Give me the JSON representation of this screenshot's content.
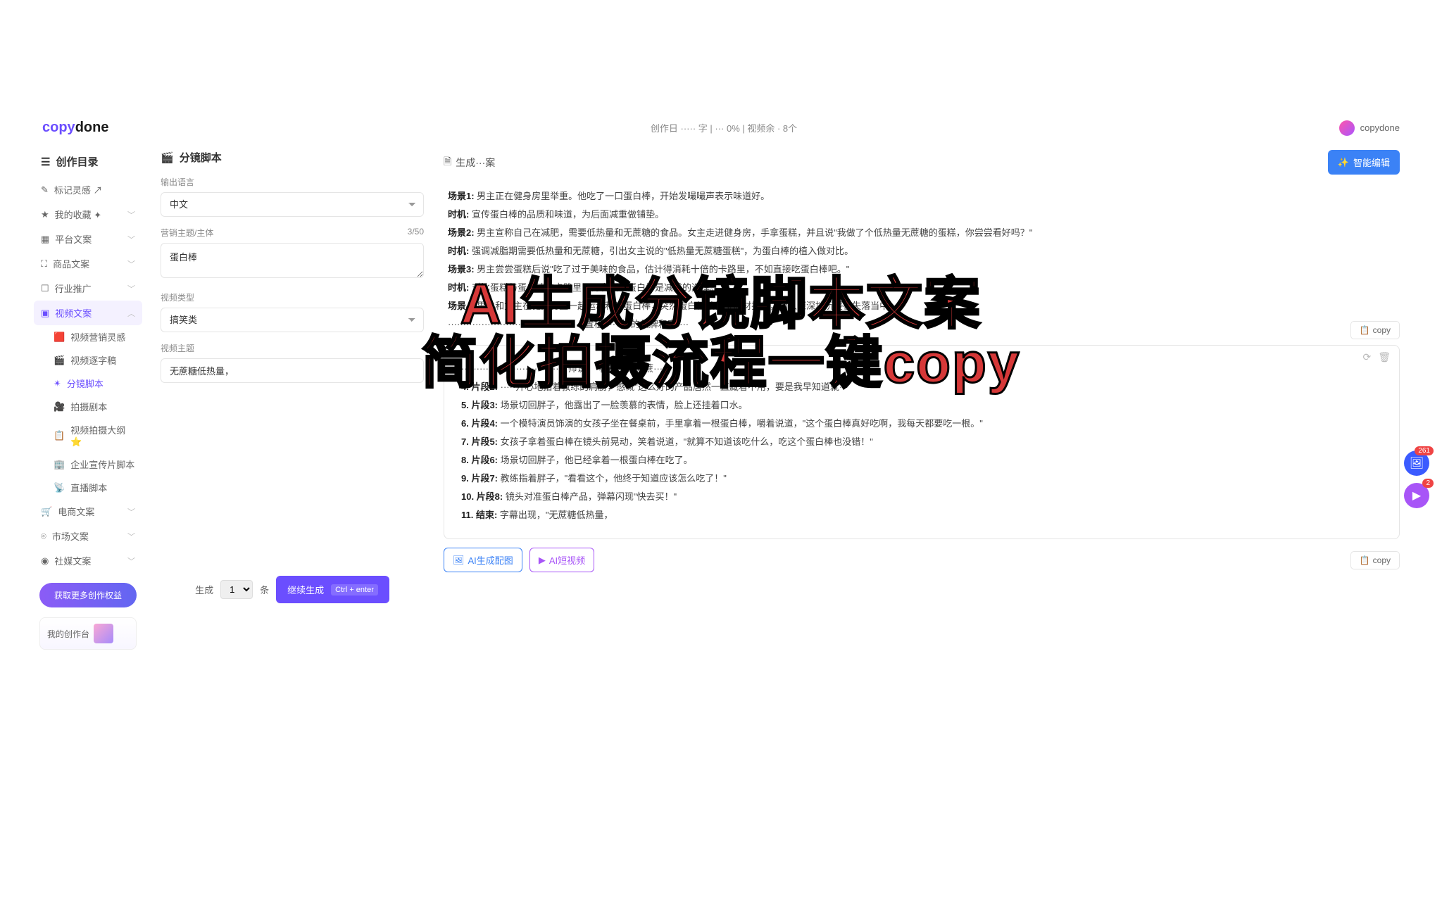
{
  "brand": {
    "p1": "copy",
    "p2": "done"
  },
  "top": {
    "center": "创作日 ····· 字 | ··· 0% | 视频余 · 8个",
    "user": "copydone"
  },
  "sidebar": {
    "title": "创作目录",
    "items": [
      {
        "icon": "✎",
        "label": "标记灵感 ↗"
      },
      {
        "icon": "★",
        "label": "我的收藏 ✦",
        "chev": true
      },
      {
        "icon": "▦",
        "label": "平台文案",
        "chev": true
      },
      {
        "icon": "⛶",
        "label": "商品文案",
        "chev": true
      },
      {
        "icon": "☐",
        "label": "行业推广",
        "chev": true
      },
      {
        "icon": "▣",
        "label": "视频文案",
        "chev": true,
        "active": true
      },
      {
        "icon": "🛒",
        "label": "电商文案",
        "chev": true
      },
      {
        "icon": "⌾",
        "label": "市场文案",
        "chev": true
      },
      {
        "icon": "◉",
        "label": "社媒文案",
        "chev": true
      }
    ],
    "sub": [
      {
        "icon": "🟥",
        "label": "视频营销灵感"
      },
      {
        "icon": "🎬",
        "label": "视频逐字稿"
      },
      {
        "icon": "✴",
        "label": "分镜脚本",
        "sel": true
      },
      {
        "icon": "🎥",
        "label": "拍摄剧本"
      },
      {
        "icon": "📋",
        "label": "视频拍摄大纲 ⭐"
      },
      {
        "icon": "🏢",
        "label": "企业宣传片脚本"
      },
      {
        "icon": "📡",
        "label": "直播脚本"
      }
    ],
    "upgrade": "获取更多创作权益",
    "workbench": "我的创作台"
  },
  "form": {
    "title": "分镜脚本",
    "lang_label": "输出语言",
    "lang_value": "中文",
    "topic_label": "营销主题/主体",
    "topic_count": "3/50",
    "topic_value": "蛋白棒",
    "type_label": "视频类型",
    "type_value": "搞笑类",
    "theme_label": "视频主题",
    "theme_value": "无蔗糖低热量，",
    "gen_label": "生成",
    "gen_count": "1",
    "gen_unit": "条",
    "gen_btn": "继续生成",
    "gen_kb": "Ctrl + enter"
  },
  "output": {
    "head": "生成···案",
    "smart": "智能编辑",
    "copy": "copy",
    "lines1": [
      "<b>场景1:</b> 男主正在健身房里举重。他吃了一口蛋白棒，开始发嘬嘬声表示味道好。",
      "<b>时机:</b> 宣传蛋白棒的品质和味道，为后面减重做铺垫。",
      "<b>场景2:</b> 男主宣称自己在减肥，需要低热量和无蔗糖的食品。女主走进健身房，手拿蛋糕，并且说\"我做了个低热量无蔗糖的蛋糕，你尝尝看好吗？\"",
      "<b>时机:</b> 强调减脂期需要低热量和无蔗糖，引出女主说的\"低热量无蔗糖蛋糕\"，为蛋白棒的植入做对比。",
      "<b>场景3:</b> 男主尝尝蛋糕后说\"吃了过于美味的食品，估计得消耗十倍的卡路里，不如直接吃蛋白棒吧。\"",
      "<b>时机:</b> 对比蛋糕与蛋白棒的卡路里，再次强调蛋白棒是减重的选择。",
      "<b>场景4:</b> 男主和女主在健身房里一起运动和吃蛋白棒，突然蛋白棒被健身器材挂住，两人深深地沉浸在失落当中。",
      "·············································置植······棒的品牌和宣····"
    ],
    "lines2": [
      "···································师说，\"看这个，无蔗···",
      "<b>4. 片段2:</b> ·····开心地拍着教练的肩膀，感慨\"这么好的产品居然一直藏着不用，要是我早知道就···",
      "<b>5. 片段3:</b> 场景切回胖子，他露出了一脸羡慕的表情，脸上还挂着口水。",
      "<b>6. 片段4:</b> 一个模特演员饰演的女孩子坐在餐桌前，手里拿着一根蛋白棒，嚼着说道，\"这个蛋白棒真好吃啊，我每天都要吃一根。\"",
      "<b>7. 片段5:</b> 女孩子拿着蛋白棒在镜头前晃动，笑着说道，\"就算不知道该吃什么，吃这个蛋白棒也没错！\"",
      "<b>8. 片段6:</b> 场景切回胖子，他已经拿着一根蛋白棒在吃了。",
      "<b>9. 片段7:</b> 教练指着胖子，\"看看这个，他终于知道应该怎么吃了！\"",
      "<b>10. 片段8:</b> 镜头对准蛋白棒产品，弹幕闪现\"快去买！\"",
      "<b>11. 结束:</b> 字幕出现，\"无蔗糖低热量，"
    ],
    "ai_img": "AI生成配图",
    "ai_vid": "AI短视频"
  },
  "overlay": {
    "l1": "AI生成分镜脚本文案",
    "l2": "简化拍摄流程一键copy"
  },
  "floats": {
    "b1": "261",
    "b2": "2"
  }
}
